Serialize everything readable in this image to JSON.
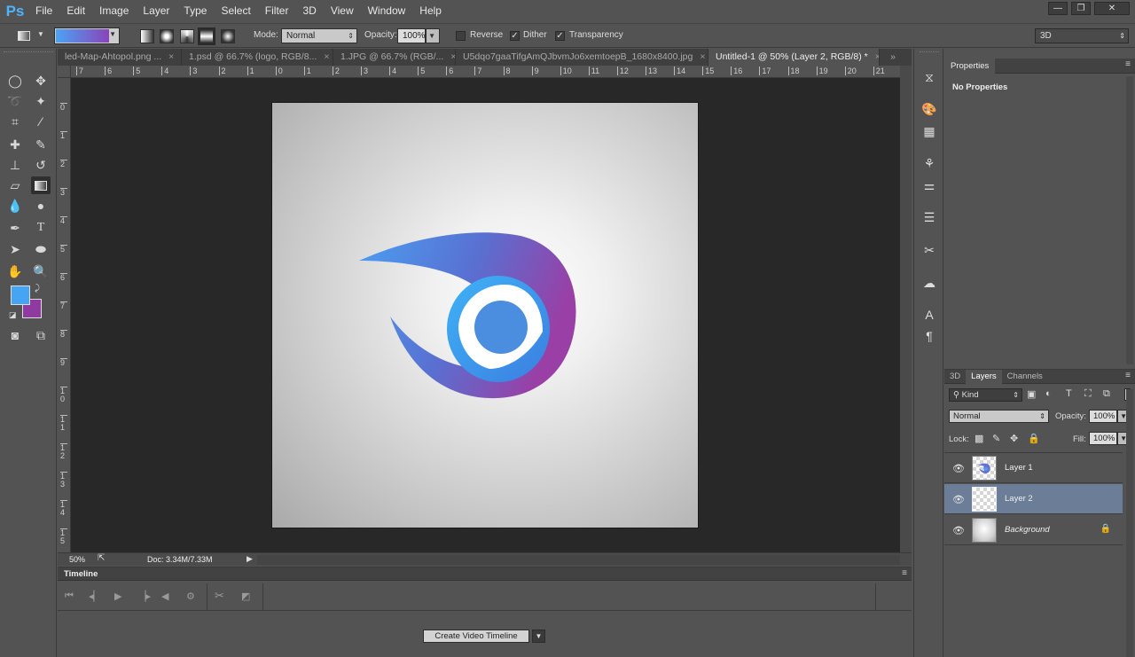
{
  "app": {
    "logo": "Ps"
  },
  "menu": [
    "File",
    "Edit",
    "Image",
    "Layer",
    "Type",
    "Select",
    "Filter",
    "3D",
    "View",
    "Window",
    "Help"
  ],
  "window_controls": {
    "minimize": "—",
    "restore": "❐",
    "close": "✕"
  },
  "options_bar": {
    "gradient_colors": [
      "#4aa3f5",
      "#8a44b8"
    ],
    "mode_label": "Mode:",
    "mode_value": "Normal",
    "opacity_label": "Opacity:",
    "opacity_value": "100%",
    "reverse_label": "Reverse",
    "reverse_checked": false,
    "dither_label": "Dither",
    "dither_checked": true,
    "transparency_label": "Transparency",
    "transparency_checked": true,
    "workspace_value": "3D"
  },
  "tabs": [
    {
      "label": "led-Map-Ahtopol.png ...",
      "active": false
    },
    {
      "label": "1.psd @ 66.7% (logo, RGB/8...",
      "active": false
    },
    {
      "label": "1.JPG @ 66.7% (RGB/...",
      "active": false
    },
    {
      "label": "U5dqo7gaaTifgAmQJbvmJo6xemtoepB_1680x8400.jpg",
      "active": false
    },
    {
      "label": "Untitled-1 @ 50% (Layer 2, RGB/8) *",
      "active": true
    }
  ],
  "tabs_overflow": "»",
  "ruler_top_labels": [
    "7",
    "6",
    "5",
    "4",
    "3",
    "2",
    "1",
    "0",
    "1",
    "2",
    "3",
    "4",
    "5",
    "6",
    "7",
    "8",
    "9",
    "10",
    "11",
    "12",
    "13",
    "14",
    "15",
    "16",
    "17",
    "18",
    "19",
    "20",
    "21"
  ],
  "ruler_left_labels": [
    "0",
    "1",
    "2",
    "3",
    "4",
    "5",
    "6",
    "7",
    "8",
    "9",
    "10",
    "11",
    "12",
    "13",
    "14",
    "15"
  ],
  "colors": {
    "foreground": "#45a4f3",
    "background": "#8e3aa0"
  },
  "status": {
    "zoom": "50%",
    "doc": "Doc: 3.34M/7.33M"
  },
  "timeline": {
    "title": "Timeline",
    "create_button": "Create Video Timeline"
  },
  "properties": {
    "tab": "Properties",
    "body": "No Properties"
  },
  "layers_panel": {
    "tabs": [
      "3D",
      "Layers",
      "Channels"
    ],
    "active_tab": "Layers",
    "filter_value": "Kind",
    "blend_mode": "Normal",
    "opacity_label": "Opacity:",
    "opacity_value": "100%",
    "lock_label": "Lock:",
    "fill_label": "Fill:",
    "fill_value": "100%",
    "layers": [
      {
        "name": "Layer 1",
        "visible": true,
        "selected": false,
        "locked": false
      },
      {
        "name": "Layer 2",
        "visible": true,
        "selected": true,
        "locked": false
      },
      {
        "name": "Background",
        "visible": true,
        "selected": false,
        "locked": true
      }
    ]
  }
}
